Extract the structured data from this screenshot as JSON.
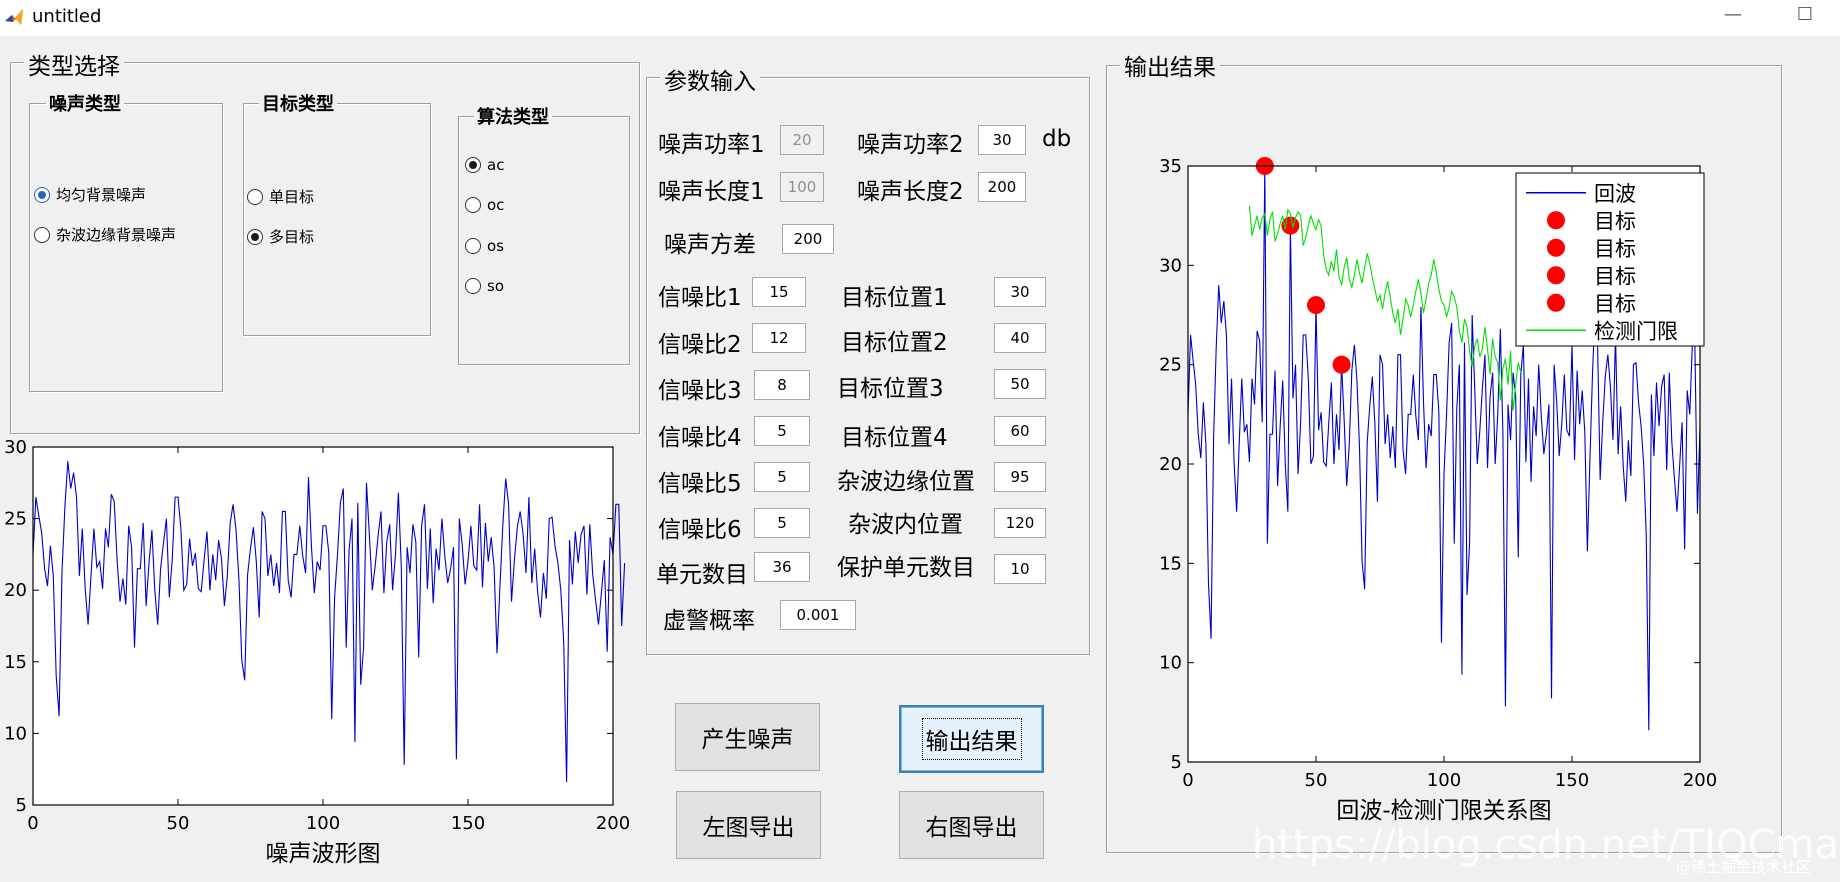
{
  "window": {
    "title": "untitled",
    "minimize": "—",
    "maximize": "☐"
  },
  "type_select": {
    "title": "类型选择",
    "noise_type": {
      "title": "噪声类型",
      "options": [
        "均匀背景噪声",
        "杂波边缘背景噪声"
      ],
      "selected": 0
    },
    "target_type": {
      "title": "目标类型",
      "options": [
        "单目标",
        "多目标"
      ],
      "selected": 1
    },
    "algo_type": {
      "title": "算法类型",
      "options": [
        "ac",
        "oc",
        "os",
        "so"
      ],
      "selected": 0
    }
  },
  "params": {
    "title": "参数输入",
    "unit_db": "db",
    "noise_power1": {
      "label": "噪声功率1",
      "value": "20"
    },
    "noise_power2": {
      "label": "噪声功率2",
      "value": "30"
    },
    "noise_len1": {
      "label": "噪声长度1",
      "value": "100"
    },
    "noise_len2": {
      "label": "噪声长度2",
      "value": "200"
    },
    "noise_var": {
      "label": "噪声方差",
      "value": "200"
    },
    "snr": [
      {
        "label": "信噪比1",
        "value": "15"
      },
      {
        "label": "信噪比2",
        "value": "12"
      },
      {
        "label": "信噪比3",
        "value": "8"
      },
      {
        "label": "信噪比4",
        "value": "5"
      },
      {
        "label": "信噪比5",
        "value": "5"
      },
      {
        "label": "信噪比6",
        "value": "5"
      }
    ],
    "target_pos": [
      {
        "label": "目标位置1",
        "value": "30"
      },
      {
        "label": "目标位置2",
        "value": "40"
      },
      {
        "label": "目标位置3",
        "value": "50"
      },
      {
        "label": "目标位置4",
        "value": "60"
      },
      {
        "label": "杂波边缘位置",
        "value": "95"
      },
      {
        "label": "杂波内位置",
        "value": "120"
      }
    ],
    "cell_count": {
      "label": "单元数目",
      "value": "36"
    },
    "guard_count": {
      "label": "保护单元数目",
      "value": "10"
    },
    "pfa": {
      "label": "虚警概率",
      "value": "0.001"
    }
  },
  "buttons": {
    "gen_noise": "产生噪声",
    "output": "输出结果",
    "export_left": "左图导出",
    "export_right": "右图导出"
  },
  "output": {
    "title": "输出结果"
  },
  "watermark": {
    "url": "https://blog.csdn.net/TIQCmatlab",
    "site": "@稀土掘金技术社区"
  },
  "chart_data": [
    {
      "type": "line",
      "title": "",
      "xlabel": "噪声波形图",
      "ylabel": "",
      "xlim": [
        0,
        200
      ],
      "ylim": [
        5,
        30
      ],
      "xticks": [
        0,
        50,
        100,
        150,
        200
      ],
      "yticks": [
        5,
        10,
        15,
        20,
        25,
        30
      ],
      "grid": false,
      "series": [
        {
          "color": "#0000c8",
          "values": [
            22.5,
            26.5,
            25.2,
            24,
            21.5,
            20.3,
            23.1,
            21,
            14,
            11.2,
            21.3,
            25.8,
            29,
            27.1,
            28.2,
            26.5,
            21,
            24.3,
            20.1,
            17.6,
            21,
            24.3,
            21.6,
            22,
            20.1,
            24.3,
            23,
            26.7,
            26.2,
            22.1,
            19.2,
            20.8,
            19,
            24.5,
            23,
            16,
            21.5,
            21.5,
            24.7,
            18.9,
            21.9,
            24.2,
            20,
            17.6,
            21.5,
            23.3,
            25,
            19.5,
            22.1,
            26.5,
            26.5,
            24.3,
            20,
            20.4,
            23.6,
            21.7,
            22.6,
            20.1,
            19.9,
            22.1,
            24.1,
            20,
            22.5,
            20.7,
            23.5,
            22.2,
            18.9,
            21,
            24.7,
            26,
            24.2,
            20.8,
            15.1,
            13.7,
            21.1,
            22.9,
            24.4,
            22,
            18.1,
            25.5,
            25,
            21,
            22.5,
            20.3,
            21.9,
            19.8,
            25.5,
            25.5,
            20.7,
            19.5,
            22.5,
            22.5,
            24.5,
            22.4,
            21.2,
            27.9,
            23.1,
            19.8,
            22,
            21.4,
            24.5,
            24.5,
            22.6,
            11,
            19.5,
            22.5,
            26.1,
            27.1,
            16,
            22.8,
            25,
            9.4,
            26.1,
            13.4,
            16,
            27.5,
            23.8,
            20,
            21.7,
            23.8,
            25.5,
            19.8,
            23.4,
            24.6,
            20,
            22.5,
            26.8,
            21.6,
            7.8,
            23,
            21.2,
            24.6,
            23.4,
            15.3,
            24.5,
            26,
            20.1,
            24.3,
            19.1,
            22.9,
            21.4,
            25,
            22.4,
            20.5,
            21.5,
            23,
            8.2,
            25,
            23.2,
            20.4,
            22,
            24.5,
            21.7,
            21.4,
            26,
            20.2,
            24.7,
            22,
            23.7,
            21.6,
            15.6,
            20.2,
            24.5,
            27.8,
            26,
            19.2,
            22.1,
            24.4,
            25.5,
            23.9,
            21.2,
            26.5,
            20.5,
            22.9,
            19.9,
            18.1,
            21.2,
            19.4,
            25,
            25.1,
            23.1,
            21.9,
            20,
            16.4,
            6.6,
            23.5,
            20.4,
            24.1,
            21.9,
            23.9,
            24.5,
            19.7,
            24.6,
            21.1,
            19.3,
            17.6,
            19.8,
            22.1,
            15.7,
            23.7,
            22.5,
            26,
            26,
            17.5,
            21.9
          ]
        }
      ]
    },
    {
      "type": "line",
      "title": "",
      "xlabel": "回波-检测门限关系图",
      "ylabel": "",
      "xlim": [
        0,
        200
      ],
      "ylim": [
        5,
        35
      ],
      "xticks": [
        0,
        50,
        100,
        150,
        200
      ],
      "yticks": [
        5,
        10,
        15,
        20,
        25,
        30,
        35
      ],
      "grid": false,
      "legend": {
        "position": "top-right",
        "entries": [
          "回波",
          "目标",
          "目标",
          "目标",
          "目标",
          "检测门限"
        ]
      },
      "series": [
        {
          "name": "回波",
          "color": "#0000c8",
          "values": [
            22.5,
            26.5,
            25.2,
            24,
            21.5,
            20.3,
            23.1,
            21,
            14,
            11.2,
            21.3,
            25.8,
            29,
            27.1,
            28.2,
            26.5,
            21,
            24.3,
            20.1,
            17.6,
            21,
            24.3,
            21.6,
            22,
            20.1,
            24.3,
            23,
            26.7,
            26.2,
            22.1,
            35,
            16,
            21.5,
            21.5,
            24.7,
            18.9,
            21.9,
            24.2,
            20,
            17.6,
            32,
            23.3,
            25,
            19.5,
            22.1,
            26.5,
            26.5,
            24.3,
            20,
            20.4,
            28,
            21.7,
            22.6,
            20.1,
            19.9,
            22.1,
            24.1,
            20,
            22.5,
            20.7,
            25,
            22.2,
            18.9,
            21,
            24.7,
            26,
            24.2,
            20.8,
            15.1,
            13.7,
            21.1,
            22.9,
            24.4,
            22,
            18.1,
            25.5,
            25,
            21,
            22.5,
            20.3,
            21.9,
            19.8,
            25.5,
            25.5,
            20.7,
            19.5,
            22.5,
            22.5,
            24.5,
            22.4,
            21.2,
            27.9,
            23.1,
            19.8,
            22,
            21.4,
            24.5,
            24.5,
            22.6,
            11,
            19.5,
            22.5,
            26.1,
            27.1,
            16,
            22.8,
            25,
            9.4,
            26.1,
            13.4,
            16,
            27.5,
            23.8,
            20,
            21.7,
            23.8,
            25.5,
            19.8,
            23.4,
            24.6,
            20,
            22.5,
            26.8,
            21.6,
            7.8,
            23,
            21.2,
            24.6,
            23.4,
            15.3,
            24.5,
            26,
            20.1,
            24.3,
            19.1,
            22.9,
            21.4,
            25,
            22.4,
            20.5,
            21.5,
            23,
            8.2,
            25,
            23.2,
            20.4,
            22,
            24.5,
            21.7,
            21.4,
            26,
            20.2,
            24.7,
            22,
            23.7,
            21.6,
            15.6,
            20.2,
            24.5,
            27.8,
            26,
            19.2,
            22.1,
            24.4,
            25.5,
            23.9,
            21.2,
            26.5,
            20.5,
            22.9,
            19.9,
            18.1,
            21.2,
            19.4,
            25,
            25.1,
            23.1,
            21.9,
            20,
            16.4,
            6.6,
            23.5,
            20.4,
            24.1,
            21.9,
            23.9,
            24.5,
            19.7,
            24.6,
            21.1,
            19.3,
            17.6,
            19.8,
            22.1,
            15.7,
            23.7,
            22.5,
            26,
            26,
            17.5,
            21.9
          ]
        },
        {
          "name": "目标",
          "color": "#ff0000",
          "type": "scatter",
          "points": [
            [
              30,
              35
            ],
            [
              40,
              32
            ],
            [
              50,
              28
            ],
            [
              60,
              25
            ]
          ]
        },
        {
          "name": "检测门限",
          "color": "#00e000",
          "x_start": 24,
          "values": [
            33,
            31.5,
            32,
            32.5,
            31.8,
            32.4,
            32.6,
            31.5,
            32.3,
            32.7,
            31.2,
            31.6,
            32.1,
            32.5,
            31.8,
            32.8,
            32.6,
            31.9,
            32.4,
            32.7,
            32.5,
            31,
            31.4,
            32,
            32.5,
            32.1,
            31.8,
            32.3,
            32,
            30.5,
            29.8,
            29.5,
            30.2,
            29.7,
            30.8,
            29.4,
            29,
            29.9,
            30.4,
            29.3,
            28.9,
            29.5,
            30.3,
            29.6,
            29.1,
            29.9,
            30.6,
            30.1,
            29.4,
            28.8,
            28.2,
            28.5,
            27.8,
            28.6,
            29.2,
            28.4,
            27.6,
            27.1,
            27.8,
            26.5,
            27.3,
            28.3,
            28,
            27.4,
            28,
            28.7,
            29.3,
            28.6,
            27.6,
            28.3,
            29.1,
            29.5,
            30.3,
            29.6,
            28.8,
            28.2,
            28,
            27.4,
            27.9,
            28.7,
            28.4,
            27.9,
            26.7,
            26.1,
            27.3,
            26.9,
            25.7,
            24.9,
            25.9,
            26.3,
            25.4,
            25.8,
            26.9,
            25.8,
            24.5,
            26.3,
            25.4,
            25.1,
            23.2,
            24.8,
            25.3,
            24,
            25.7,
            22.7,
            24,
            25.1,
            24.6
          ]
        }
      ]
    }
  ]
}
